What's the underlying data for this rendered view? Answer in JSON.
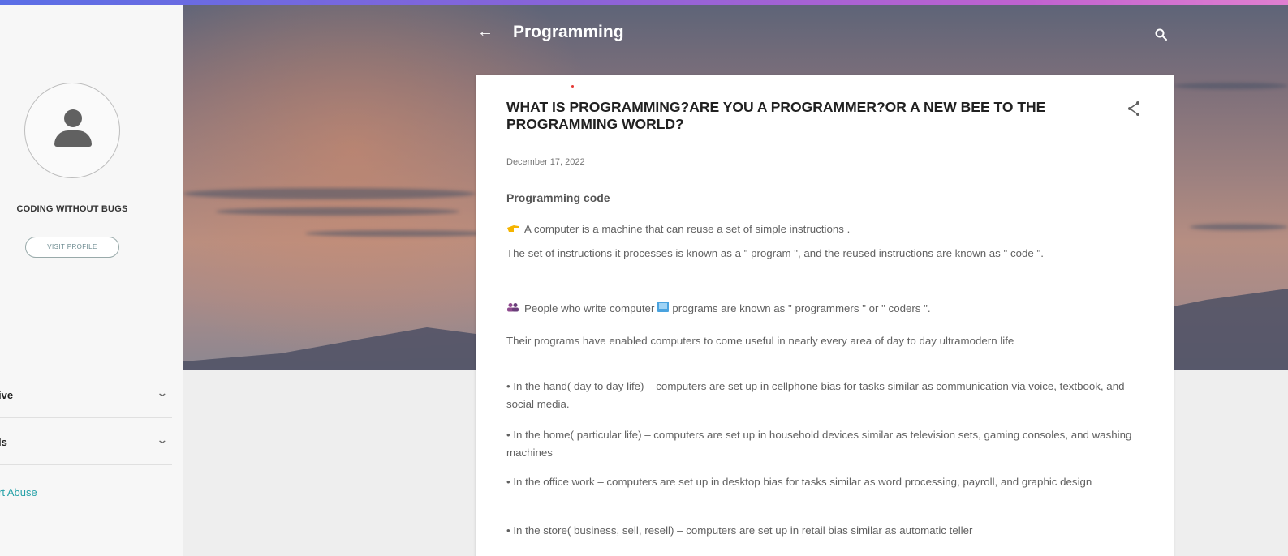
{
  "colors": {
    "accent_teal": "#26a1a8",
    "top_strip": "#8a63d8",
    "title_text": "#212121"
  },
  "sidebar": {
    "blog_name": "CODING WITHOUT BUGS",
    "visit_profile_label": "VISIT PROFILE",
    "items": [
      {
        "label": "ive",
        "icon": "chevron-down-icon"
      },
      {
        "label": "ls",
        "icon": "chevron-down-icon"
      }
    ],
    "report_label": "rt Abuse"
  },
  "header": {
    "back_icon": "arrow-left-icon",
    "title": "Programming",
    "search_icon": "search-icon"
  },
  "post": {
    "title": "WHAT IS PROGRAMMING?ARE YOU A PROGRAMMER?OR A NEW BEE TO THE PROGRAMMING WORLD?",
    "share_icon": "share-icon",
    "date": "December 17, 2022",
    "section_heading": "Programming code",
    "paragraphs": {
      "p1": "A computer is a machine that can reuse a set of simple instructions .",
      "p2": "The set of instructions it processes is known as a \" program \", and the reused instructions are known as \" code \".",
      "p3a": "People who write computer",
      "p3b": "programs are known as \" programmers \" or \" coders \".",
      "p4": "Their programs have enabled computers to come useful in  nearly every area of day to day ultramodern life",
      "p5": "• In the hand( day to day life) – computers are  set up in cellphone  bias for tasks  similar as communication via voice,  textbook, and social media.",
      "p6": " • In the home(  particular life) – computers are  set up in household devices  similar as television sets, gaming consoles, and washing machines",
      "p7": "• In the office work – computers are  set up in desktop  bias for tasks  similar as word  processing, payroll, and graphic design",
      "p8": "• In the store( business, sell, resell) – computers are  set up in retail  bias  similar as automatic teller"
    },
    "emojis": [
      "pointing-hand-icon",
      "people-icon",
      "computer-icon"
    ]
  }
}
